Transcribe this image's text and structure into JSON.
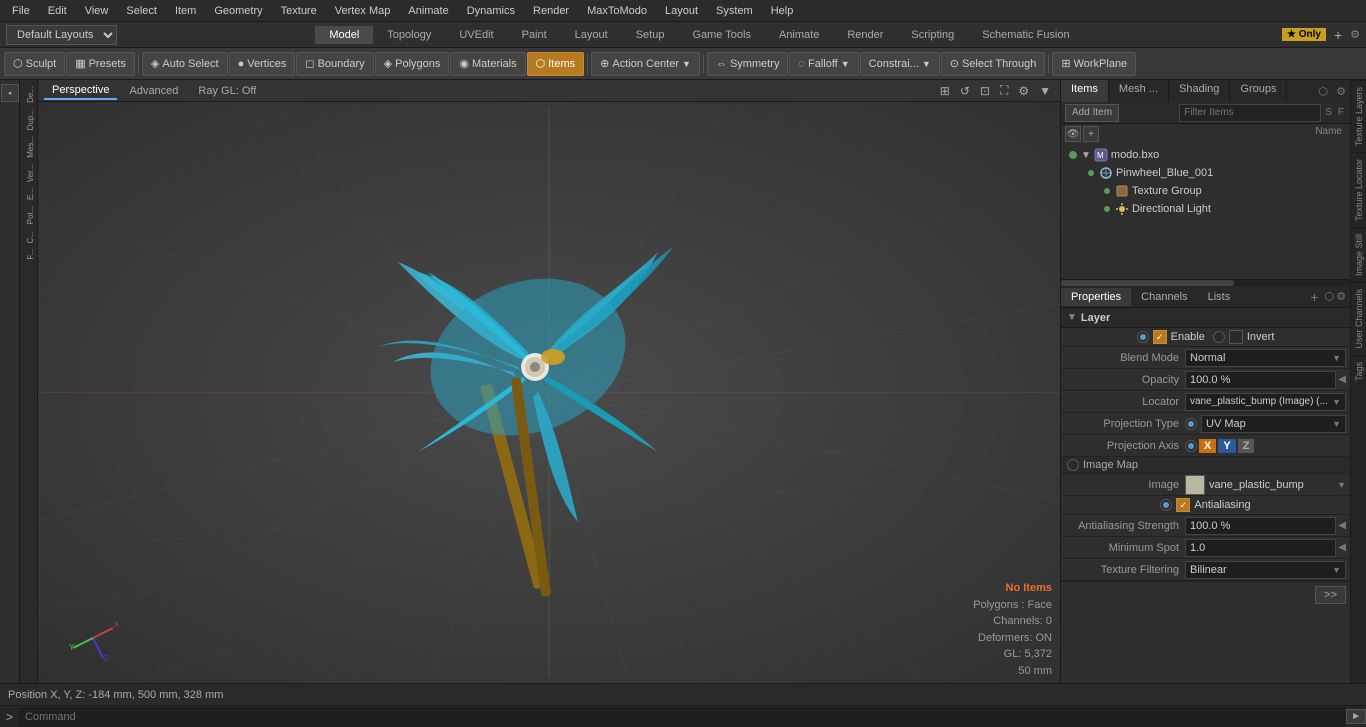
{
  "menubar": {
    "items": [
      "File",
      "Edit",
      "View",
      "Select",
      "Item",
      "Geometry",
      "Texture",
      "Vertex Map",
      "Animate",
      "Dynamics",
      "Render",
      "MaxToModo",
      "Layout",
      "System",
      "Help"
    ]
  },
  "layout_bar": {
    "dropdown": "Default Layouts",
    "tabs": [
      "Model",
      "Topology",
      "UVEdit",
      "Paint",
      "Layout",
      "Setup",
      "Game Tools",
      "Animate",
      "Render",
      "Scripting",
      "Schematic Fusion"
    ],
    "active_tab": "Model",
    "star_label": "★ Only",
    "plus": "+"
  },
  "toolbar": {
    "sculpt": "Sculpt",
    "presets": "Presets",
    "auto_select": "Auto Select",
    "vertices": "Vertices",
    "boundary": "Boundary",
    "polygons": "Polygons",
    "materials": "Materials",
    "items": "Items",
    "action_center": "Action Center",
    "symmetry": "Symmetry",
    "falloff": "Falloff",
    "constraints": "Constrai...",
    "select_through": "Select Through",
    "workplane": "WorkPlane"
  },
  "viewport": {
    "tabs": [
      "Perspective",
      "Advanced",
      "Ray GL: Off"
    ],
    "active_tab": "Perspective"
  },
  "items_panel": {
    "tabs": [
      "Items",
      "Mesh ...",
      "Shading",
      "Groups"
    ],
    "active_tab": "Items",
    "add_item": "Add Item",
    "filter_placeholder": "Filter Items",
    "col_name": "Name",
    "tree": [
      {
        "name": "modo.bxo",
        "level": 0,
        "type": "scene",
        "has_eye": true,
        "expanded": true
      },
      {
        "name": "Pinwheel_Blue_001",
        "level": 1,
        "type": "mesh",
        "has_eye": true
      },
      {
        "name": "Texture Group",
        "level": 2,
        "type": "texture",
        "has_eye": true
      },
      {
        "name": "Directional Light",
        "level": 2,
        "type": "light",
        "has_eye": true
      }
    ]
  },
  "properties_panel": {
    "tabs": [
      "Properties",
      "Channels",
      "Lists"
    ],
    "active_tab": "Properties",
    "section": "Layer",
    "rows": [
      {
        "label": "",
        "type": "checkboxes",
        "items": [
          {
            "label": "Enable",
            "checked": true
          },
          {
            "label": "Invert",
            "checked": false
          }
        ]
      },
      {
        "label": "Blend Mode",
        "type": "dropdown",
        "value": "Normal"
      },
      {
        "label": "Opacity",
        "type": "input",
        "value": "100.0 %"
      },
      {
        "label": "Locator",
        "type": "input",
        "value": "vane_plastic_bump (Image) (... ▼"
      },
      {
        "label": "Projection Type",
        "type": "dropdown_radio",
        "value": "UV Map"
      },
      {
        "label": "Projection Axis",
        "type": "xyz",
        "x": "X",
        "y": "Y",
        "z": "Z"
      },
      {
        "label": "Image Map",
        "type": "section_label"
      },
      {
        "label": "Image",
        "type": "image",
        "value": "vane_plastic_bump"
      },
      {
        "label": "",
        "type": "checkbox_single",
        "label2": "Antialiasing",
        "checked": true
      },
      {
        "label": "Antialiasing Strength",
        "type": "input_btn",
        "value": "100.0 %"
      },
      {
        "label": "Minimum Spot",
        "type": "input_btn",
        "value": "1.0"
      },
      {
        "label": "Texture Filtering",
        "type": "dropdown",
        "value": "Bilinear"
      }
    ]
  },
  "right_side_tabs": [
    "Texture Layers",
    "Texture Locator",
    "Image Still",
    "User Channels",
    "Tags"
  ],
  "status_bar": {
    "text": "Position X, Y, Z:  -184 mm, 500 mm, 328 mm"
  },
  "command_bar": {
    "arrow": ">",
    "placeholder": "Command",
    "btn_label": "►"
  },
  "viewport_stats": {
    "no_items": "No Items",
    "polygons": "Polygons : Face",
    "channels": "Channels: 0",
    "deformers": "Deformers: ON",
    "gl": "GL: 5,372",
    "size": "50 mm"
  }
}
